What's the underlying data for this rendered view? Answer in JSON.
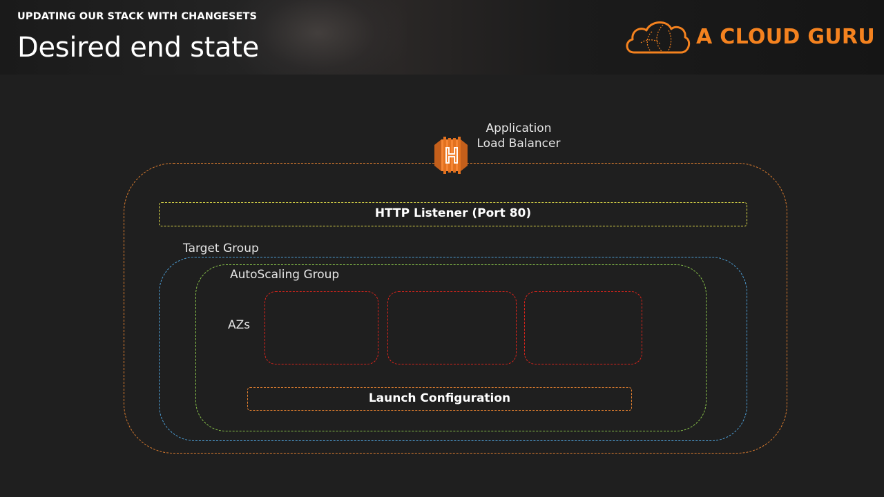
{
  "header": {
    "kicker": "UPDATING OUR STACK WITH CHANGESETS",
    "title": "Desired end state",
    "logo_text": "A CLOUD GURU",
    "brand_color": "#f4821f"
  },
  "diagram": {
    "alb_label_line1": "Application",
    "alb_label_line2": "Load Balancer",
    "alb_icon": "aws-elastic-load-balancing-icon",
    "listener_label": "HTTP Listener (Port 80)",
    "target_group_label": "Target Group",
    "asg_label": "AutoScaling Group",
    "azs_label": "AZs",
    "az_count": 3,
    "launch_config_label": "Launch Configuration",
    "colors": {
      "alb": "#e8822f",
      "listener": "#e6e24a",
      "target_group": "#4fa3dc",
      "asg": "#8cc84b",
      "az": "#e0241b",
      "launch_config": "#e8822f"
    }
  }
}
